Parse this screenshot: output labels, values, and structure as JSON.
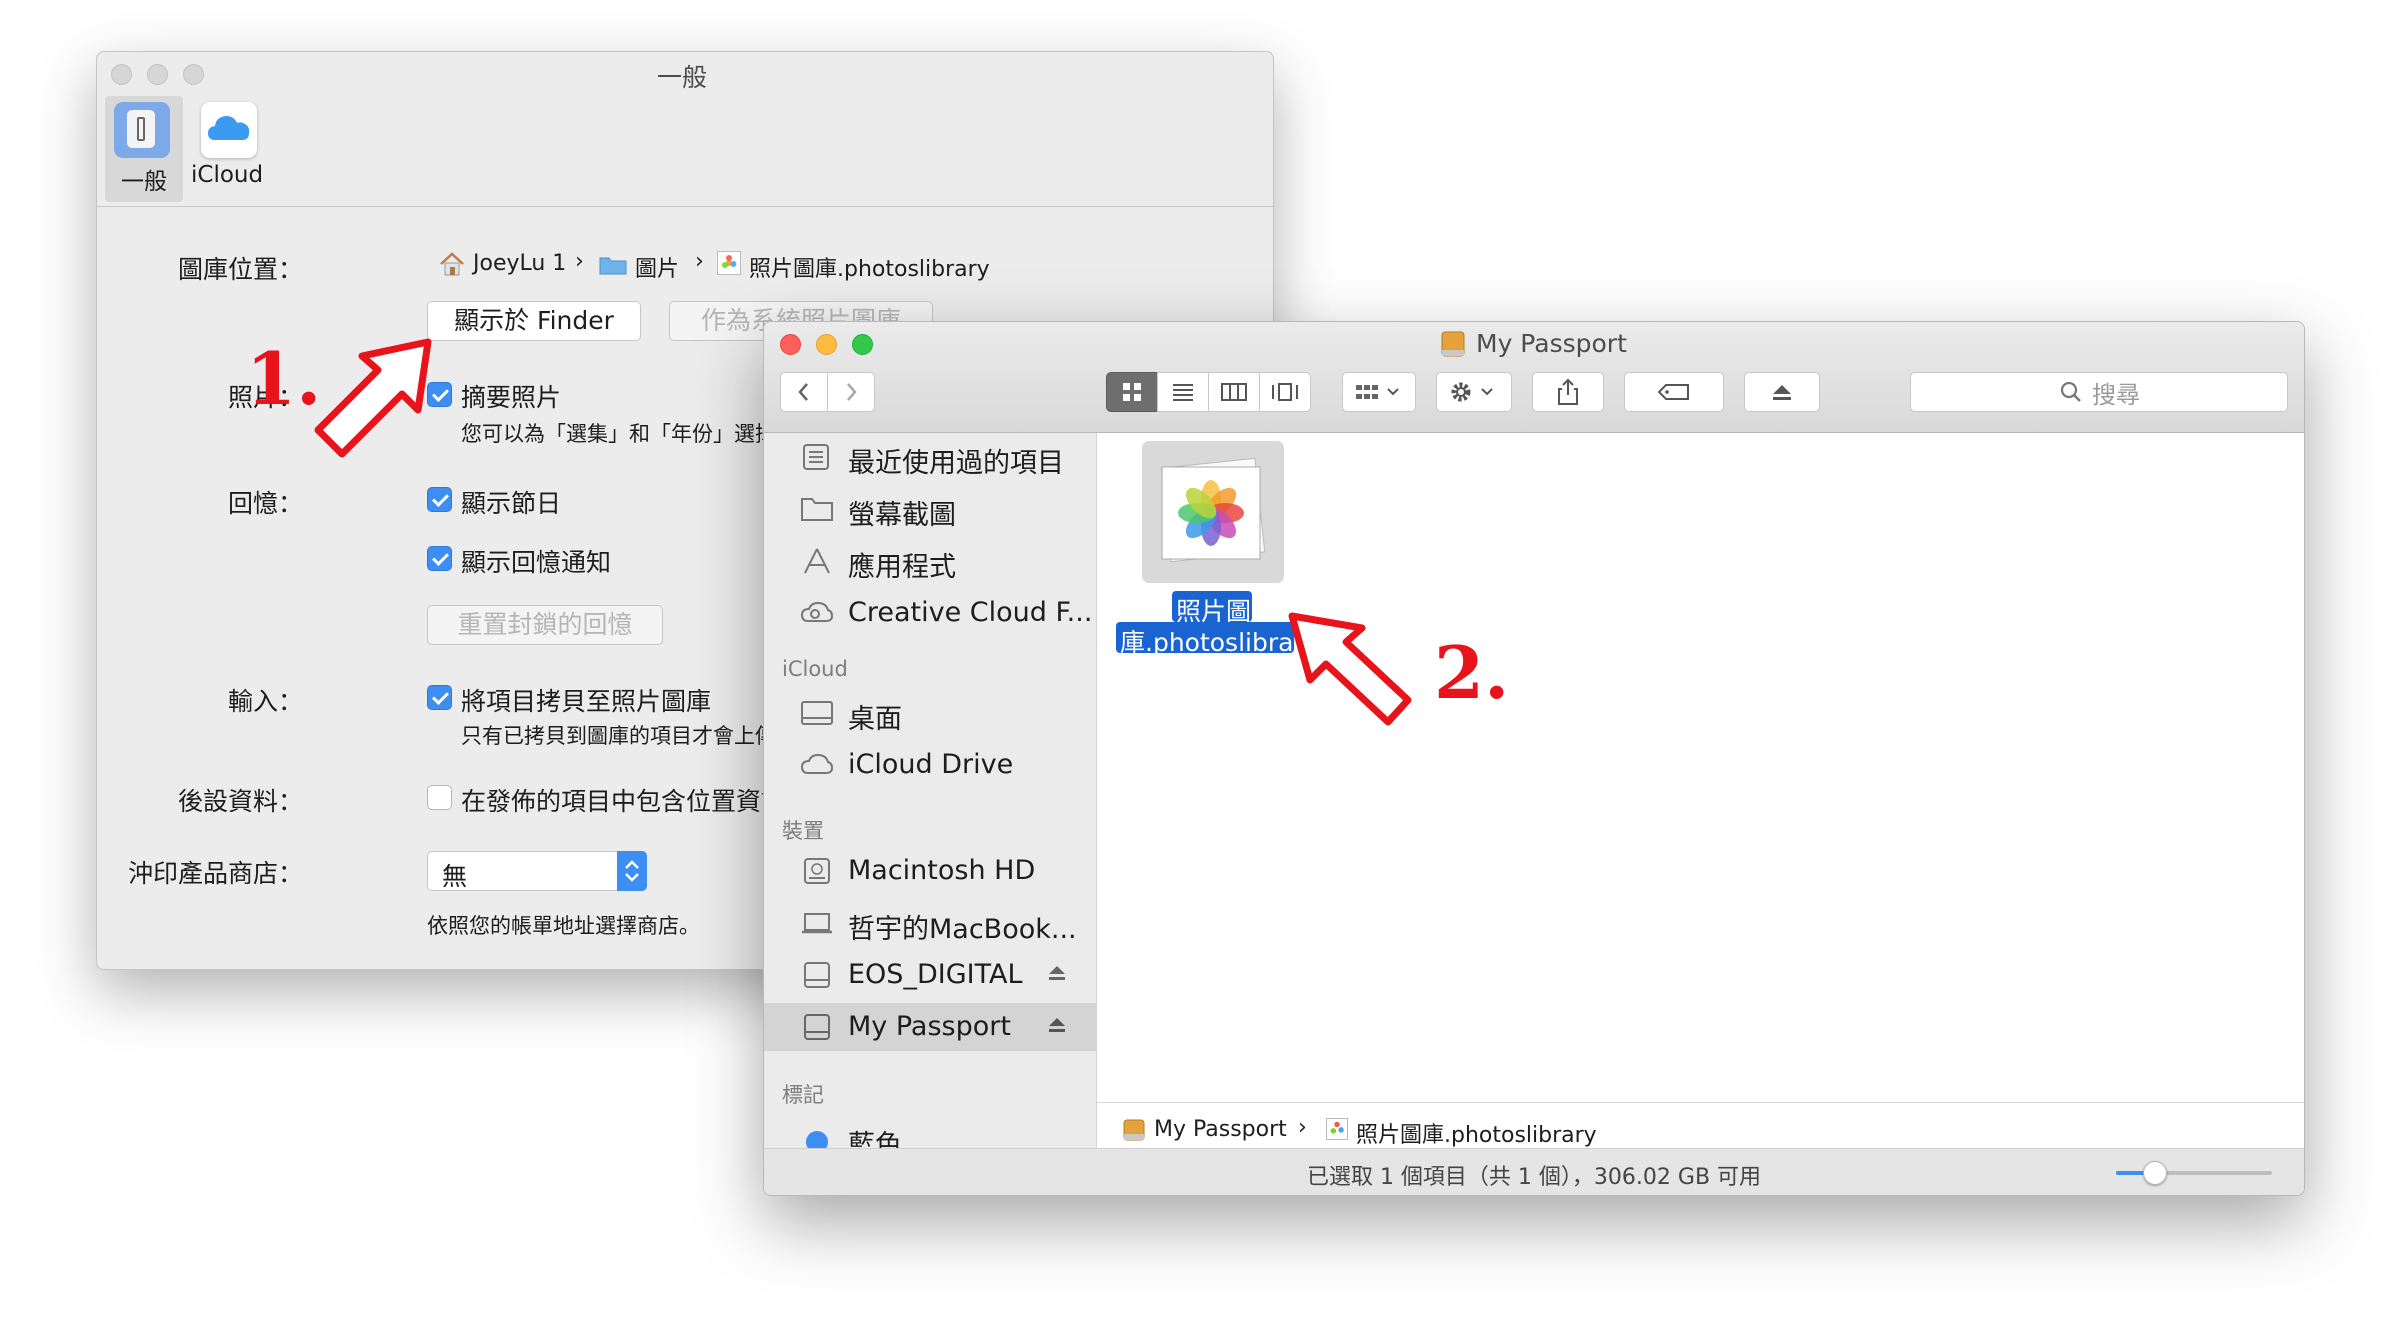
{
  "prefs": {
    "title": "一般",
    "tabs": [
      {
        "label": "一般"
      },
      {
        "label": "iCloud"
      }
    ],
    "library_label": "圖庫位置：",
    "path": [
      "JoeyLu 1",
      "圖片",
      "照片圖庫.photoslibrary"
    ],
    "show_in_finder": "顯示於 Finder",
    "system_library": "作為系統照片圖庫",
    "photos_label": "照片：",
    "summary_photos": "摘要照片",
    "summary_desc": "您可以為「選集」和「年份」選擇摘要照片",
    "memories_label": "回憶：",
    "show_holidays": "顯示節日",
    "show_memory_notif": "顯示回憶通知",
    "reset_memories": "重置封鎖的回憶",
    "import_label": "輸入：",
    "copy_items": "將項目拷貝至照片圖庫",
    "copy_desc": "只有已拷貝到圖庫的項目才會上傳",
    "metadata_label": "後設資料：",
    "include_location": "在發佈的項目中包含位置資訊",
    "print_store_label": "沖印產品商店：",
    "print_store_value": "無",
    "print_store_desc": "依照您的帳單地址選擇商店。"
  },
  "finder": {
    "title": "My Passport",
    "search_placeholder": "搜尋",
    "favorites": [
      "最近使用過的項目",
      "螢幕截圖",
      "應用程式",
      "Creative Cloud F..."
    ],
    "icloud_header": "iCloud",
    "icloud_items": [
      "桌面",
      "iCloud Drive"
    ],
    "devices_header": "裝置",
    "devices": [
      "Macintosh HD",
      "哲宇的MacBook...",
      "EOS_DIGITAL",
      "My Passport"
    ],
    "tags_header": "標記",
    "tags": [
      "藍色"
    ],
    "file_name_line1": "照片圖",
    "file_name_line2": "庫.photoslibrary",
    "pathbar": [
      "My Passport",
      "照片圖庫.photoslibrary"
    ],
    "status": "已選取 1 個項目（共 1 個），306.02 GB 可用",
    "icon_size_fraction": 0.25
  },
  "annotations": {
    "step1": "1.",
    "step2": "2."
  },
  "colors": {
    "accent": "#3c8ef3",
    "selection": "#1a64d2",
    "annotation_red": "#e8141b"
  }
}
